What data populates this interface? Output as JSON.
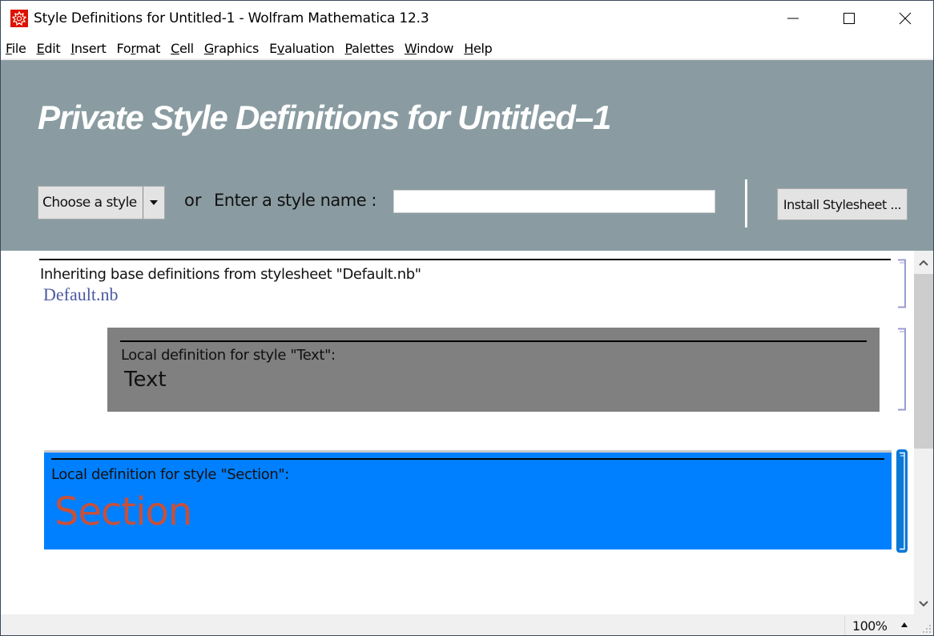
{
  "window": {
    "title": "Style Definitions for Untitled-1 - Wolfram Mathematica 12.3",
    "app_icon": "wolfram-spikey-icon",
    "controls": [
      "minimize-icon",
      "maximize-icon",
      "close-icon"
    ]
  },
  "menu": [
    {
      "label": "File",
      "accel": "F",
      "rest": "ile"
    },
    {
      "label": "Edit",
      "accel": "E",
      "rest": "dit"
    },
    {
      "label": "Insert",
      "accel": "I",
      "rest": "nsert"
    },
    {
      "label": "Format",
      "pre": "Fo",
      "accel": "r",
      "rest": "mat"
    },
    {
      "label": "Cell",
      "accel": "C",
      "rest": "ell"
    },
    {
      "label": "Graphics",
      "accel": "G",
      "rest": "raphics"
    },
    {
      "label": "Evaluation",
      "pre": "E",
      "accel": "v",
      "rest": "aluation"
    },
    {
      "label": "Palettes",
      "accel": "P",
      "rest": "alettes"
    },
    {
      "label": "Window",
      "accel": "W",
      "rest": "indow"
    },
    {
      "label": "Help",
      "accel": "H",
      "rest": "elp"
    }
  ],
  "header": {
    "title": "Private Style Definitions for  Untitled–1",
    "style_select": {
      "selected": "Choose a style"
    },
    "or_label": "or",
    "enter_label": "Enter a style name :",
    "style_input": {
      "value": "",
      "placeholder": ""
    },
    "install_button": "Install Stylesheet ..."
  },
  "notebook": {
    "inherit_cell": {
      "text": "Inheriting base definitions from stylesheet \"Default.nb\"",
      "link": "Default.nb"
    },
    "cells": [
      {
        "description": "Local definition for style \"Text\":",
        "sample": "Text",
        "background": "#808080",
        "selected": false
      },
      {
        "description": "Local definition for style \"Section\":",
        "sample": "Section",
        "background": "#0080ff",
        "sample_color": "#c8503a",
        "selected": true
      }
    ]
  },
  "statusbar": {
    "zoom": "100%"
  },
  "colors": {
    "header_bg": "#8a9ca2",
    "bracket": "#9a9ad6",
    "selected_bracket": "#0a78d7"
  }
}
